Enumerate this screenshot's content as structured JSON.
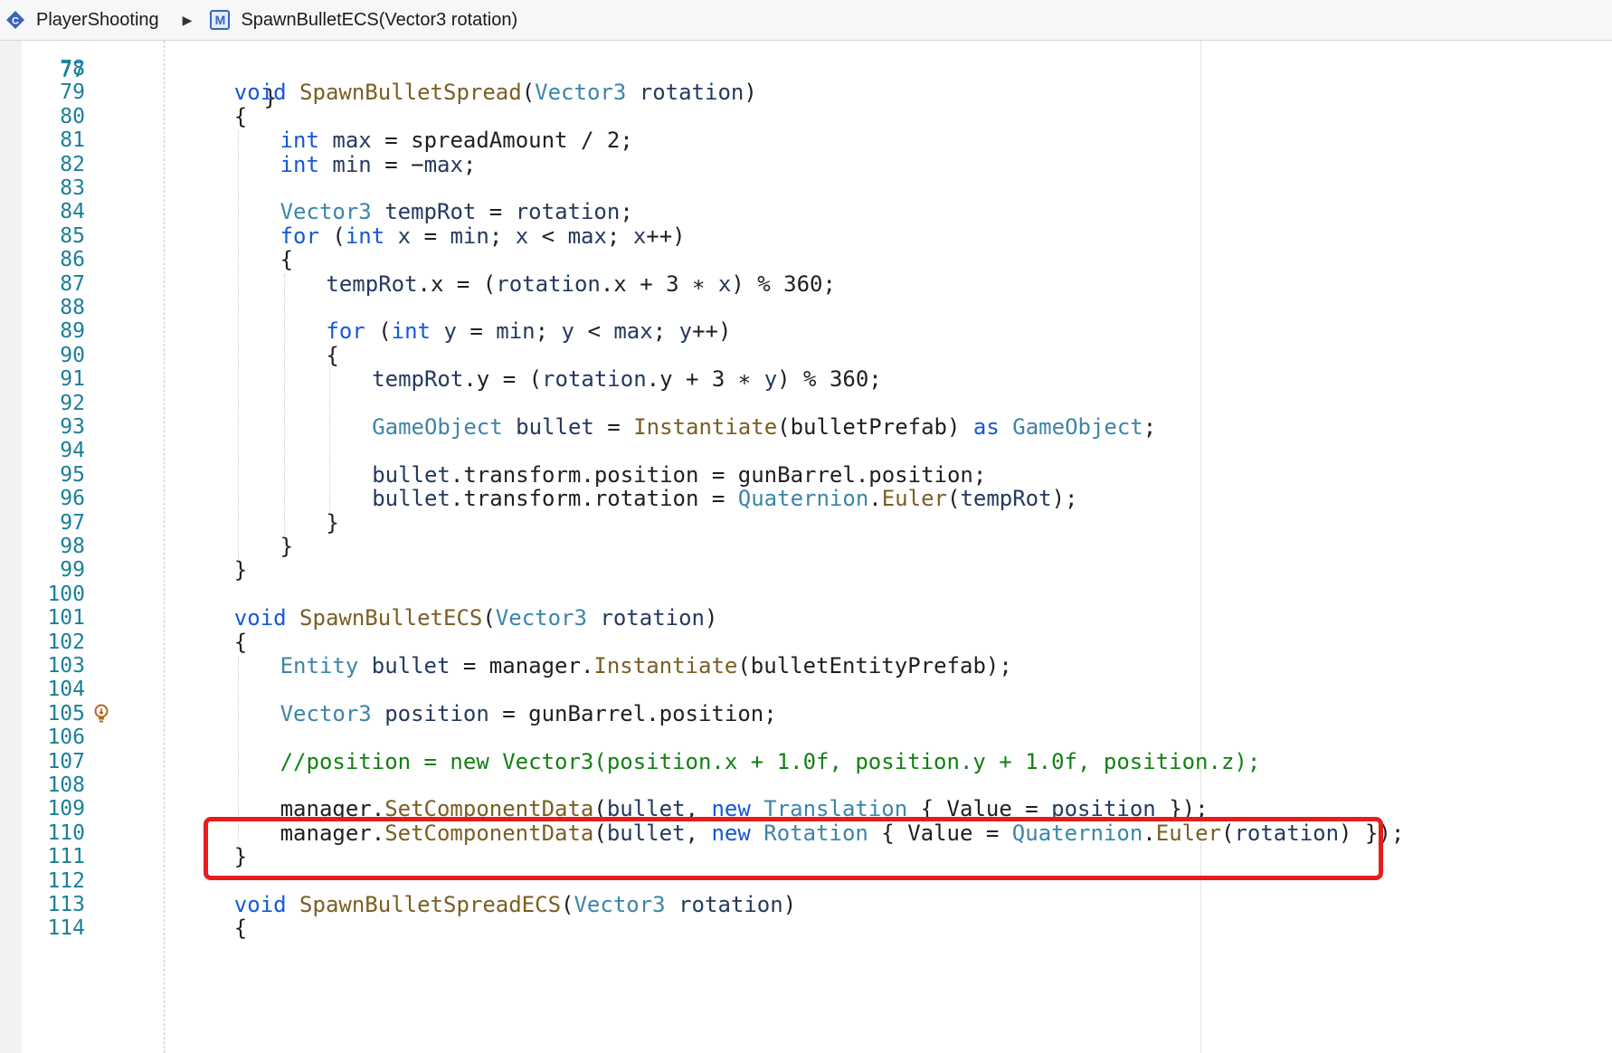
{
  "breadcrumb": {
    "class_name": "PlayerShooting",
    "method_name": "SpawnBulletECS(Vector3 rotation)",
    "method_badge": "M"
  },
  "editor": {
    "top_partial": {
      "number": "77",
      "code": "    }"
    },
    "lines": [
      {
        "n": "78",
        "indent": 0,
        "tokens": []
      },
      {
        "n": "79",
        "indent": 4,
        "tokens": [
          [
            "kw",
            "void"
          ],
          [
            "pl",
            " "
          ],
          [
            "fn",
            "SpawnBulletSpread"
          ],
          [
            "pl",
            "("
          ],
          [
            "ty",
            "Vector3"
          ],
          [
            "pl",
            " "
          ],
          [
            "vr",
            "rotation"
          ],
          [
            "pl",
            ")"
          ]
        ]
      },
      {
        "n": "80",
        "indent": 4,
        "tokens": [
          [
            "pl",
            "{"
          ]
        ]
      },
      {
        "n": "81",
        "indent": 8,
        "tokens": [
          [
            "kw",
            "int"
          ],
          [
            "pl",
            " "
          ],
          [
            "vr",
            "max"
          ],
          [
            "pl",
            " = spreadAmount / 2;"
          ]
        ]
      },
      {
        "n": "82",
        "indent": 8,
        "tokens": [
          [
            "kw",
            "int"
          ],
          [
            "pl",
            " "
          ],
          [
            "vr",
            "min"
          ],
          [
            "pl",
            " = −"
          ],
          [
            "vr",
            "max"
          ],
          [
            "pl",
            ";"
          ]
        ]
      },
      {
        "n": "83",
        "indent": 0,
        "tokens": []
      },
      {
        "n": "84",
        "indent": 8,
        "tokens": [
          [
            "ty",
            "Vector3"
          ],
          [
            "pl",
            " "
          ],
          [
            "vr",
            "tempRot"
          ],
          [
            "pl",
            " = "
          ],
          [
            "vr",
            "rotation"
          ],
          [
            "pl",
            ";"
          ]
        ]
      },
      {
        "n": "85",
        "indent": 8,
        "tokens": [
          [
            "kw",
            "for"
          ],
          [
            "pl",
            " ("
          ],
          [
            "kw",
            "int"
          ],
          [
            "pl",
            " "
          ],
          [
            "vr",
            "x"
          ],
          [
            "pl",
            " = "
          ],
          [
            "vr",
            "min"
          ],
          [
            "pl",
            "; "
          ],
          [
            "vr",
            "x"
          ],
          [
            "pl",
            " < "
          ],
          [
            "vr",
            "max"
          ],
          [
            "pl",
            "; "
          ],
          [
            "vr",
            "x"
          ],
          [
            "pl",
            "++)"
          ]
        ]
      },
      {
        "n": "86",
        "indent": 8,
        "tokens": [
          [
            "pl",
            "{"
          ]
        ]
      },
      {
        "n": "87",
        "indent": 12,
        "tokens": [
          [
            "vr",
            "tempRot"
          ],
          [
            "pl",
            ".x = ("
          ],
          [
            "vr",
            "rotation"
          ],
          [
            "pl",
            ".x + 3 ∗ "
          ],
          [
            "vr",
            "x"
          ],
          [
            "pl",
            ") % 360;"
          ]
        ]
      },
      {
        "n": "88",
        "indent": 0,
        "tokens": []
      },
      {
        "n": "89",
        "indent": 12,
        "tokens": [
          [
            "kw",
            "for"
          ],
          [
            "pl",
            " ("
          ],
          [
            "kw",
            "int"
          ],
          [
            "pl",
            " "
          ],
          [
            "vr",
            "y"
          ],
          [
            "pl",
            " = "
          ],
          [
            "vr",
            "min"
          ],
          [
            "pl",
            "; "
          ],
          [
            "vr",
            "y"
          ],
          [
            "pl",
            " < "
          ],
          [
            "vr",
            "max"
          ],
          [
            "pl",
            "; "
          ],
          [
            "vr",
            "y"
          ],
          [
            "pl",
            "++)"
          ]
        ]
      },
      {
        "n": "90",
        "indent": 12,
        "tokens": [
          [
            "pl",
            "{"
          ]
        ]
      },
      {
        "n": "91",
        "indent": 16,
        "tokens": [
          [
            "vr",
            "tempRot"
          ],
          [
            "pl",
            ".y = ("
          ],
          [
            "vr",
            "rotation"
          ],
          [
            "pl",
            ".y + 3 ∗ "
          ],
          [
            "vr",
            "y"
          ],
          [
            "pl",
            ") % 360;"
          ]
        ]
      },
      {
        "n": "92",
        "indent": 0,
        "tokens": []
      },
      {
        "n": "93",
        "indent": 16,
        "tokens": [
          [
            "ty",
            "GameObject"
          ],
          [
            "pl",
            " "
          ],
          [
            "vr",
            "bullet"
          ],
          [
            "pl",
            " = "
          ],
          [
            "fn",
            "Instantiate"
          ],
          [
            "pl",
            "(bulletPrefab) "
          ],
          [
            "kw",
            "as"
          ],
          [
            "pl",
            " "
          ],
          [
            "ty",
            "GameObject"
          ],
          [
            "pl",
            ";"
          ]
        ]
      },
      {
        "n": "94",
        "indent": 0,
        "tokens": []
      },
      {
        "n": "95",
        "indent": 16,
        "tokens": [
          [
            "vr",
            "bullet"
          ],
          [
            "pl",
            ".transform.position = gunBarrel.position;"
          ]
        ]
      },
      {
        "n": "96",
        "indent": 16,
        "tokens": [
          [
            "vr",
            "bullet"
          ],
          [
            "pl",
            ".transform.rotation = "
          ],
          [
            "ty",
            "Quaternion"
          ],
          [
            "pl",
            "."
          ],
          [
            "fn",
            "Euler"
          ],
          [
            "pl",
            "("
          ],
          [
            "vr",
            "tempRot"
          ],
          [
            "pl",
            ");"
          ]
        ]
      },
      {
        "n": "97",
        "indent": 12,
        "tokens": [
          [
            "pl",
            "}"
          ]
        ]
      },
      {
        "n": "98",
        "indent": 8,
        "tokens": [
          [
            "pl",
            "}"
          ]
        ]
      },
      {
        "n": "99",
        "indent": 4,
        "tokens": [
          [
            "pl",
            "}"
          ]
        ]
      },
      {
        "n": "100",
        "indent": 0,
        "tokens": []
      },
      {
        "n": "101",
        "indent": 4,
        "tokens": [
          [
            "kw",
            "void"
          ],
          [
            "pl",
            " "
          ],
          [
            "fn",
            "SpawnBulletECS"
          ],
          [
            "pl",
            "("
          ],
          [
            "ty",
            "Vector3"
          ],
          [
            "pl",
            " "
          ],
          [
            "vr",
            "rotation"
          ],
          [
            "pl",
            ")"
          ]
        ]
      },
      {
        "n": "102",
        "indent": 4,
        "tokens": [
          [
            "pl",
            "{"
          ]
        ]
      },
      {
        "n": "103",
        "indent": 8,
        "tokens": [
          [
            "ty",
            "Entity"
          ],
          [
            "pl",
            " "
          ],
          [
            "vr",
            "bullet"
          ],
          [
            "pl",
            " = manager."
          ],
          [
            "fn",
            "Instantiate"
          ],
          [
            "pl",
            "(bulletEntityPrefab);"
          ]
        ]
      },
      {
        "n": "104",
        "indent": 0,
        "tokens": []
      },
      {
        "n": "105",
        "indent": 8,
        "bulb": true,
        "tokens": [
          [
            "ty",
            "Vector3"
          ],
          [
            "pl",
            " "
          ],
          [
            "vr",
            "position"
          ],
          [
            "pl",
            " = gunBarrel.position;"
          ]
        ]
      },
      {
        "n": "106",
        "indent": 0,
        "tokens": []
      },
      {
        "n": "107",
        "indent": 8,
        "tokens": [
          [
            "cm",
            "//position = new Vector3(position.x + 1.0f, position.y + 1.0f, position.z);"
          ]
        ]
      },
      {
        "n": "108",
        "indent": 0,
        "tokens": []
      },
      {
        "n": "109",
        "indent": 8,
        "tokens": [
          [
            "pl",
            "manager."
          ],
          [
            "fn",
            "SetComponentData"
          ],
          [
            "pl",
            "("
          ],
          [
            "vr",
            "bullet"
          ],
          [
            "pl",
            ", "
          ],
          [
            "kw",
            "new"
          ],
          [
            "pl",
            " "
          ],
          [
            "ty",
            "Translation"
          ],
          [
            "pl",
            " { Value = "
          ],
          [
            "vr",
            "position"
          ],
          [
            "pl",
            " });"
          ]
        ]
      },
      {
        "n": "110",
        "indent": 8,
        "tokens": [
          [
            "pl",
            "manager."
          ],
          [
            "fn",
            "SetComponentData"
          ],
          [
            "pl",
            "("
          ],
          [
            "vr",
            "bullet"
          ],
          [
            "pl",
            ", "
          ],
          [
            "kw",
            "new"
          ],
          [
            "pl",
            " "
          ],
          [
            "ty",
            "Rotation"
          ],
          [
            "pl",
            " { Value = "
          ],
          [
            "ty",
            "Quaternion"
          ],
          [
            "pl",
            "."
          ],
          [
            "fn",
            "Euler"
          ],
          [
            "pl",
            "("
          ],
          [
            "vr",
            "rotation"
          ],
          [
            "pl",
            ") });"
          ]
        ]
      },
      {
        "n": "111",
        "indent": 4,
        "tokens": [
          [
            "pl",
            "}"
          ]
        ]
      },
      {
        "n": "112",
        "indent": 0,
        "tokens": []
      },
      {
        "n": "113",
        "indent": 4,
        "tokens": [
          [
            "kw",
            "void"
          ],
          [
            "pl",
            " "
          ],
          [
            "fn",
            "SpawnBulletSpreadECS"
          ],
          [
            "pl",
            "("
          ],
          [
            "ty",
            "Vector3"
          ],
          [
            "pl",
            " "
          ],
          [
            "vr",
            "rotation"
          ],
          [
            "pl",
            ")"
          ]
        ]
      },
      {
        "n": "114",
        "indent": 4,
        "tokens": [
          [
            "pl",
            "{"
          ]
        ]
      }
    ]
  },
  "colors": {
    "keyword": "#1458d6",
    "type": "#3b85a8",
    "function": "#7a5e22",
    "variable": "#25395e",
    "comment": "#128012",
    "line_number": "#1a7f99",
    "highlight_border": "#e81c1c"
  },
  "icons": {
    "class": "class-icon",
    "separator": "breadcrumb-arrow-icon",
    "method": "method-icon",
    "bulb": "lightbulb-icon"
  }
}
